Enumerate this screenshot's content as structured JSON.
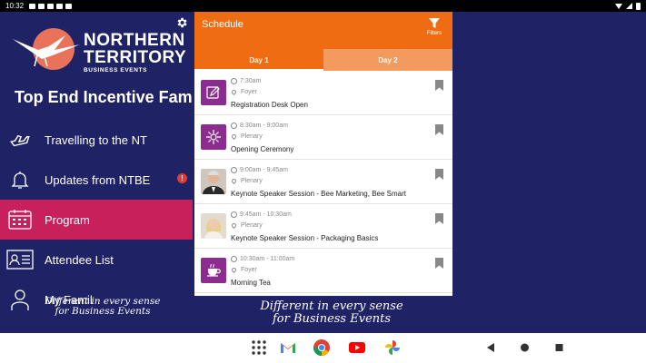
{
  "status_bar": {
    "time": "10:32"
  },
  "logo": {
    "line1": "NORTHERN",
    "line2": "TERRITORY",
    "line3": "BUSINESS EVENTS"
  },
  "event_title": "Top End Incentive Famil",
  "nav": {
    "items": [
      {
        "label": "Travelling to the NT",
        "icon": "airplane-icon"
      },
      {
        "label": "Updates from NTBE",
        "icon": "bell-icon",
        "badge": "!"
      },
      {
        "label": "Program",
        "icon": "calendar-icon",
        "active": true
      },
      {
        "label": "Attendee List",
        "icon": "contact-card-icon"
      },
      {
        "label": "My Famil",
        "icon": "person-icon"
      }
    ]
  },
  "tagline": {
    "line1": "Different in every sense",
    "line2": "for Business Events"
  },
  "schedule": {
    "title": "Schedule",
    "filters_label": "Filters",
    "tabs": [
      "Day 1",
      "Day 2"
    ],
    "sessions": [
      {
        "time": "7:30am",
        "location": "Foyer",
        "title": "Registration Desk Open",
        "thumb": "edit-icon"
      },
      {
        "time": "8:30am - 9:00am",
        "location": "Plenary",
        "title": "Opening Ceremony",
        "thumb": "celebration-icon"
      },
      {
        "time": "9:00am - 9:45am",
        "location": "Plenary",
        "title": "Keynote Speaker Session - Bee Marketing, Bee Smart",
        "thumb": "speaker-photo"
      },
      {
        "time": "9:45am - 10:30am",
        "location": "Plenary",
        "title": "Keynote Speaker Session - Packaging Basics",
        "thumb": "speaker-photo"
      },
      {
        "time": "10:30am - 11:00am",
        "location": "Foyer",
        "title": "Morning Tea",
        "thumb": "coffee-cup-icon"
      }
    ]
  },
  "colors": {
    "navy": "#1f2366",
    "orange": "#ef6c12",
    "magenta": "#c7205b",
    "purple": "#8b2c8f"
  }
}
